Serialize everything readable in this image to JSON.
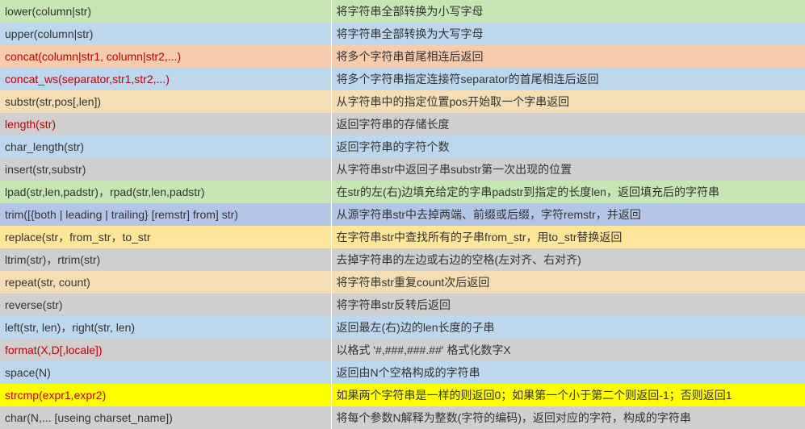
{
  "rows": [
    {
      "fn": "lower(column|str)",
      "desc": "将字符串全部转换为小写字母",
      "bg": "bg-green",
      "fnRed": false
    },
    {
      "fn": "upper(column|str)",
      "desc": "将字符串全部转换为大写字母",
      "bg": "bg-blue",
      "fnRed": false
    },
    {
      "fn": "concat(column|str1, column|str2,...)",
      "desc": "将多个字符串首尾相连后返回",
      "bg": "bg-orange",
      "fnRed": true
    },
    {
      "fn": "concat_ws(separator,str1,str2,...)",
      "desc": "将多个字符串指定连接符separator的首尾相连后返回",
      "bg": "bg-blue",
      "fnRed": true
    },
    {
      "fn": "substr(str,pos[,len])",
      "desc": "从字符串中的指定位置pos开始取一个字串返回",
      "bg": "bg-tan",
      "fnRed": false
    },
    {
      "fn": "length(str)",
      "desc": "返回字符串的存储长度",
      "bg": "bg-grey",
      "fnRed": true
    },
    {
      "fn": "char_length(str)",
      "desc": "返回字符串的字符个数",
      "bg": "bg-blue",
      "fnRed": false
    },
    {
      "fn": "insert(str,substr)",
      "desc": "从字符串str中返回子串substr第一次出现的位置",
      "bg": "bg-grey",
      "fnRed": false
    },
    {
      "fn": "lpad(str,len,padstr)，rpad(str,len,padstr)",
      "desc": "在str的左(右)边填充给定的字串padstr到指定的长度len，返回填充后的字符串",
      "bg": "bg-green",
      "fnRed": false
    },
    {
      "fn": "trim([{both | leading | trailing} [remstr] from] str)",
      "desc": "从源字符串str中去掉两端、前缀或后缀，字符remstr，并返回",
      "bg": "bg-blue2",
      "fnRed": false
    },
    {
      "fn": "replace(str，from_str，to_str",
      "desc": "在字符串str中查找所有的子串from_str，用to_str替换返回",
      "bg": "bg-amber",
      "fnRed": false
    },
    {
      "fn": "ltrim(str)，rtrim(str)",
      "desc": "去掉字符串的左边或右边的空格(左对齐、右对齐)",
      "bg": "bg-grey",
      "fnRed": false
    },
    {
      "fn": "repeat(str, count)",
      "desc": "将字符串str重复count次后返回",
      "bg": "bg-tan",
      "fnRed": false
    },
    {
      "fn": "reverse(str)",
      "desc": "将字符串str反转后返回",
      "bg": "bg-grey",
      "fnRed": false
    },
    {
      "fn": "left(str, len)，right(str, len)",
      "desc": "返回最左(右)边的len长度的子串",
      "bg": "bg-blue",
      "fnRed": false
    },
    {
      "fn": "format(X,D[,locale])",
      "desc": "以格式 '#,###,###.##' 格式化数字X",
      "bg": "bg-grey",
      "fnRed": true
    },
    {
      "fn": "space(N)",
      "desc": "返回由N个空格构成的字符串",
      "bg": "bg-blue",
      "fnRed": false
    },
    {
      "fn": "strcmp(expr1,expr2)",
      "desc": "如果两个字符串是一样的则返回0；如果第一个小于第二个则返回-1；否则返回1",
      "bg": "bg-yellow",
      "fnRed": true
    },
    {
      "fn": "char(N,... [useing  charset_name])",
      "desc": "将每个参数N解释为整数(字符的编码)，返回对应的字符，构成的字符串",
      "bg": "bg-grey",
      "fnRed": false
    }
  ]
}
